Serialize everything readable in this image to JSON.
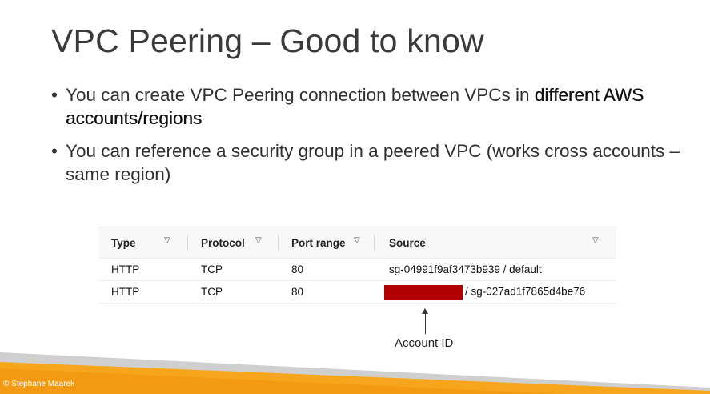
{
  "slide": {
    "title": "VPC Peering – Good to know",
    "bullets": [
      {
        "text_before": "You can create VPC Peering connection between VPCs in ",
        "bold": "different AWS accounts/regions"
      },
      {
        "text_before": "You can reference a security group in a peered VPC (works cross accounts – same region)",
        "bold": ""
      }
    ],
    "bullet_glyph": "•",
    "caret_glyph": "▽",
    "table": {
      "headers": [
        "Type",
        "Protocol",
        "Port range",
        "Source"
      ],
      "rows": [
        {
          "type": "HTTP",
          "protocol": "TCP",
          "port": "80",
          "source": "sg-04991f9af3473b939 / default"
        },
        {
          "type": "HTTP",
          "protocol": "TCP",
          "port": "80",
          "source": "/ sg-027ad1f7865d4be76"
        }
      ]
    },
    "annotation": "Account ID",
    "footer": "© Stephane Maarek",
    "colors": {
      "redaction": "#b00000",
      "footer_orange": "#f7a51c",
      "footer_grey": "#c9c9c9"
    }
  }
}
